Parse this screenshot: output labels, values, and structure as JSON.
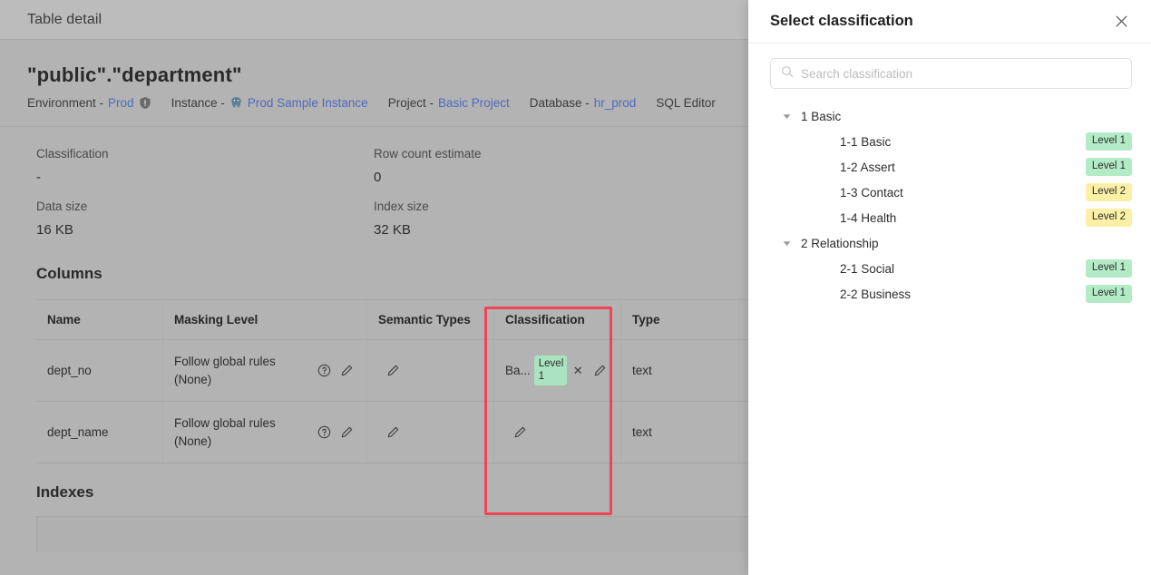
{
  "app": {
    "titlebar": {
      "title": "Table detail"
    },
    "table_title": "\"public\".\"department\"",
    "breadcrumbs": [
      {
        "label": "Environment -",
        "value": "Prod",
        "icon": "shield-exclamation-icon"
      },
      {
        "label": "Instance -",
        "value": "Prod Sample Instance",
        "icon": "postgresql-icon"
      },
      {
        "label": "Project -",
        "value": "Basic Project",
        "icon": ""
      },
      {
        "label": "Database -",
        "value": "hr_prod",
        "icon": ""
      },
      {
        "label": "SQL Editor",
        "value": "",
        "icon": ""
      }
    ],
    "stats": [
      {
        "key": "Classification",
        "value": "-"
      },
      {
        "key": "Row count estimate",
        "value": "0"
      },
      {
        "key": "Data size",
        "value": "16 KB"
      },
      {
        "key": "Index size",
        "value": "32 KB"
      }
    ],
    "columns_section": {
      "title": "Columns",
      "headers": [
        "Name",
        "Masking Level",
        "Semantic Types",
        "Classification",
        "Type",
        ""
      ],
      "rows": [
        {
          "name": "dept_no",
          "masking_level": "Follow global rules (None)",
          "semantic_types": "",
          "classification_text": "Ba...",
          "classification_chip": "Level 1",
          "type": "text"
        },
        {
          "name": "dept_name",
          "masking_level": "Follow global rules (None)",
          "semantic_types": "",
          "classification_text": "",
          "classification_chip": "",
          "type": "text"
        }
      ]
    },
    "indexes_section": {
      "title": "Indexes"
    }
  },
  "drawer": {
    "title": "Select classification",
    "close_icon": "close-icon",
    "search": {
      "placeholder": "Search classification",
      "value": "",
      "icon": "search-icon"
    },
    "tree": [
      {
        "type": "group",
        "label": "1 Basic",
        "expanded": true,
        "level": ""
      },
      {
        "type": "child",
        "label": "1-1 Basic",
        "level": "Level 1",
        "tone": "g"
      },
      {
        "type": "child",
        "label": "1-2 Assert",
        "level": "Level 1",
        "tone": "g"
      },
      {
        "type": "child",
        "label": "1-3 Contact",
        "level": "Level 2",
        "tone": "y"
      },
      {
        "type": "child",
        "label": "1-4 Health",
        "level": "Level 2",
        "tone": "y"
      },
      {
        "type": "group",
        "label": "2 Relationship",
        "expanded": true,
        "level": ""
      },
      {
        "type": "child",
        "label": "2-1 Social",
        "level": "Level 1",
        "tone": "g"
      },
      {
        "type": "child",
        "label": "2-2 Business",
        "level": "Level 1",
        "tone": "g"
      }
    ]
  },
  "colors": {
    "level1_badge": "#b3ebc6",
    "level2_badge": "#fbf0a6",
    "highlight_box": "#f04457",
    "link": "#4d6bbf",
    "overlay": "#b3b3b3"
  }
}
